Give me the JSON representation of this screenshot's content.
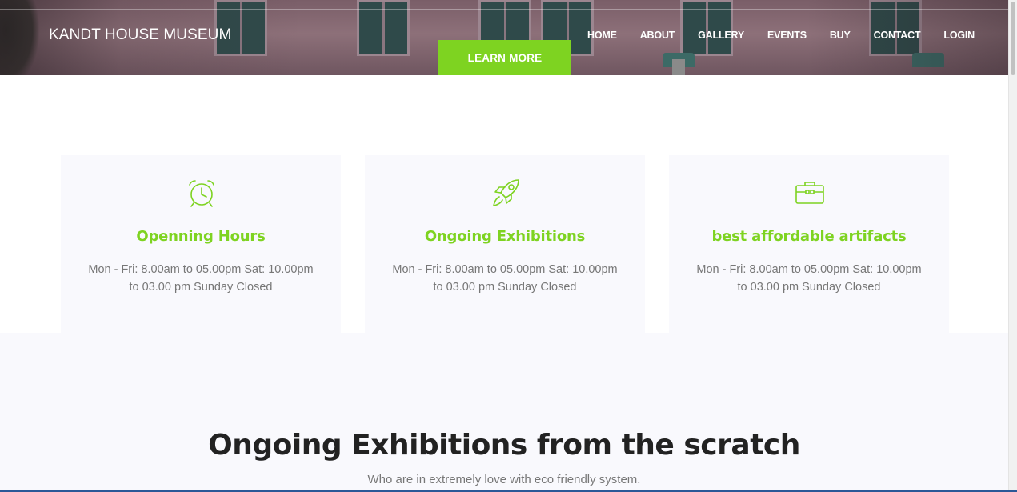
{
  "header": {
    "brand": "KANDT HOUSE MUSEUM",
    "nav": [
      "HOME",
      "ABOUT",
      "GALLERY",
      "EVENTS",
      "BUY",
      "CONTACT",
      "LOGIN"
    ],
    "cta_label": "LEARN MORE"
  },
  "features": [
    {
      "icon": "alarm-clock-icon",
      "title": "Openning Hours",
      "text": "Mon - Fri: 8.00am to 05.00pm Sat: 10.00pm to 03.00 pm Sunday Closed"
    },
    {
      "icon": "rocket-icon",
      "title": "Ongoing Exhibitions",
      "text": "Mon - Fri: 8.00am to 05.00pm Sat: 10.00pm to 03.00 pm Sunday Closed"
    },
    {
      "icon": "briefcase-icon",
      "title": "best affordable artifacts",
      "text": "Mon - Fri: 8.00am to 05.00pm Sat: 10.00pm to 03.00 pm Sunday Closed"
    }
  ],
  "exhibitions": {
    "title": "Ongoing Exhibitions from the scratch",
    "subtitle": "Who are in extremely love with eco friendly system."
  },
  "colors": {
    "accent": "#7ed321",
    "heading": "#222222",
    "body_text": "#777777",
    "card_bg": "#f9f9fd"
  }
}
